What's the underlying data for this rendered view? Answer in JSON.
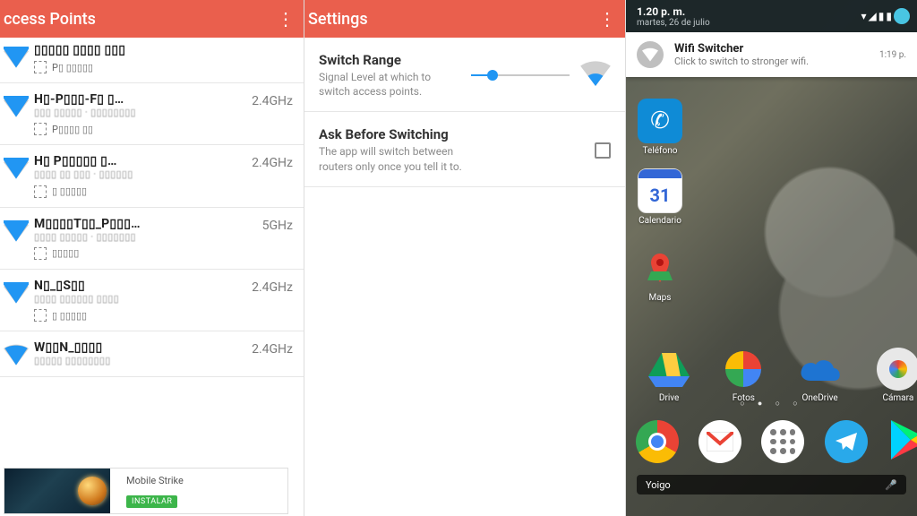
{
  "panel_aps": {
    "title": "ccess Points",
    "menu_glyph": "⋮",
    "items": [
      {
        "name": "▯▯▯▯▯ ▯▯▯▯ ▯▯▯",
        "meta1": "",
        "check_label": "P▯ ▯▯▯▯▯",
        "band": "",
        "fill": 40
      },
      {
        "name": "H▯-P▯▯▯-F▯ ▯…",
        "meta1": "▯▯▯ ▯▯▯▯▯ · ▯▯▯▯▯▯▯▯",
        "check_label": "P▯▯▯▯ ▯▯",
        "band": "2.4GHz",
        "fill": 35
      },
      {
        "name": "H▯ P▯▯▯▯▯ ▯…",
        "meta1": "▯▯▯▯ ▯▯ ▯▯▯ · ▯▯▯▯▯▯",
        "check_label": "▯ ▯▯▯▯▯",
        "band": "2.4GHz",
        "fill": 30
      },
      {
        "name": "M▯▯▯▯T▯▯_P▯▯▯…",
        "meta1": "▯▯▯▯ ▯▯▯▯▯ · ▯▯▯▯▯▯▯",
        "check_label": "▯▯▯▯▯",
        "band": "5GHz",
        "fill": 20
      },
      {
        "name": "N▯_▯S▯▯",
        "meta1": "▯▯▯▯ ▯▯▯▯▯▯ ▯▯▯▯",
        "check_label": "▯ ▯▯▯▯▯",
        "band": "2.4GHz",
        "fill": 28
      },
      {
        "name": "W▯▯N_▯▯▯▯",
        "meta1": "▯▯▯▯▯ ▯▯▯▯▯▯▯▯",
        "check_label": "",
        "band": "2.4GHz",
        "fill": 15
      }
    ]
  },
  "panel_settings": {
    "title": "Settings",
    "menu_glyph": "⋮",
    "switch_range": {
      "title": "Switch Range",
      "desc": "Signal Level at which to switch access points.",
      "value_pct": 22
    },
    "ask": {
      "title": "Ask Before Switching",
      "desc": "The app will switch between routers only once you tell it to.",
      "checked": false
    }
  },
  "phone": {
    "status": {
      "time": "1.20 p. m.",
      "date": "martes, 26 de julio",
      "icons": [
        "▾",
        "◢",
        "▮",
        "▮"
      ]
    },
    "notif": {
      "title": "Wifi Switcher",
      "sub": "Click to switch to stronger wifi.",
      "time": "1:19 p."
    },
    "apps_left": [
      {
        "label": "Teléfono",
        "glyph": "✆",
        "bg": "#0f8bd6"
      },
      {
        "label": "Calendario",
        "glyph": "31",
        "bg": "#ffffff",
        "fg": "#3367d6"
      },
      {
        "label": "Maps",
        "glyph": "◆",
        "bg": "transparent"
      }
    ],
    "row_apps": [
      {
        "label": "Drive",
        "shape": "drive"
      },
      {
        "label": "Fotos",
        "shape": "photos"
      },
      {
        "label": "OneDrive",
        "shape": "onedrive"
      },
      {
        "label": "Cámara",
        "shape": "camera",
        "partial": true
      }
    ],
    "dock": [
      {
        "shape": "chrome"
      },
      {
        "shape": "gmail"
      },
      {
        "shape": "apps"
      },
      {
        "shape": "telegram"
      },
      {
        "shape": "play",
        "partial": true
      }
    ],
    "searchbar": {
      "placeholder": "Yoigo",
      "mic": "🎤"
    }
  },
  "ad": {
    "title": "Mobile Strike",
    "button": "INSTALAR"
  }
}
